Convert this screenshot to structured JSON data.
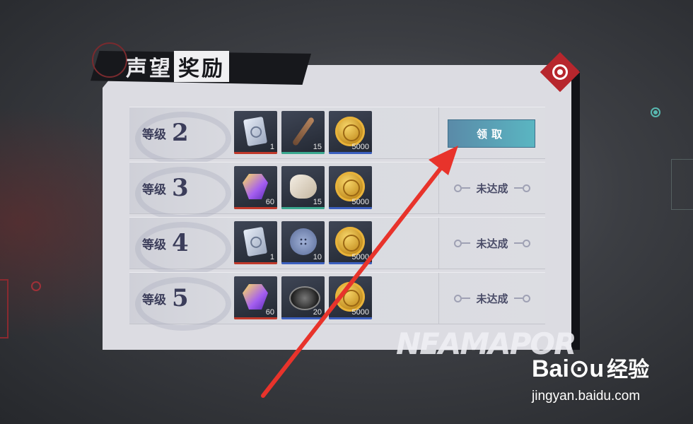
{
  "panel": {
    "title_a": "声望",
    "title_b": "奖励"
  },
  "rows": [
    {
      "level_label": "等级",
      "level_num": "2",
      "items": [
        {
          "icon": "card-icon",
          "qty": "1",
          "bar": "#c0392b"
        },
        {
          "icon": "knife-icon",
          "qty": "15",
          "bar": "#3aa88f"
        },
        {
          "icon": "coin-icon",
          "qty": "5000",
          "bar": "#3b5fbf"
        }
      ],
      "action": {
        "type": "button",
        "label": "领取"
      }
    },
    {
      "level_label": "等级",
      "level_num": "3",
      "items": [
        {
          "icon": "gem-icon",
          "qty": "60",
          "bar": "#c0392b"
        },
        {
          "icon": "cloth-icon",
          "qty": "15",
          "bar": "#3aa88f"
        },
        {
          "icon": "coin-icon",
          "qty": "5000",
          "bar": "#3b5fbf"
        }
      ],
      "action": {
        "type": "status",
        "label": "未达成"
      }
    },
    {
      "level_label": "等级",
      "level_num": "4",
      "items": [
        {
          "icon": "card-icon",
          "qty": "1",
          "bar": "#c0392b"
        },
        {
          "icon": "button-icon",
          "qty": "10",
          "bar": "#3b5fbf"
        },
        {
          "icon": "coin-icon",
          "qty": "5000",
          "bar": "#3b5fbf"
        }
      ],
      "action": {
        "type": "status",
        "label": "未达成"
      }
    },
    {
      "level_label": "等级",
      "level_num": "5",
      "items": [
        {
          "icon": "gem-icon",
          "qty": "60",
          "bar": "#c0392b"
        },
        {
          "icon": "film-reel-icon",
          "qty": "20",
          "bar": "#3b5fbf"
        },
        {
          "icon": "coin-icon",
          "qty": "5000",
          "bar": "#3b5fbf"
        }
      ],
      "action": {
        "type": "status",
        "label": "未达成"
      }
    }
  ],
  "bottom_deco_text": "NEAMAPOR",
  "watermark": {
    "brand": "Bai⊙u",
    "cn": "经验",
    "url": "jingyan.baidu.com"
  },
  "colors": {
    "accent_red": "#b7262d",
    "button_teal": "#5ab6c2",
    "annotation_arrow": "#e8332b"
  }
}
